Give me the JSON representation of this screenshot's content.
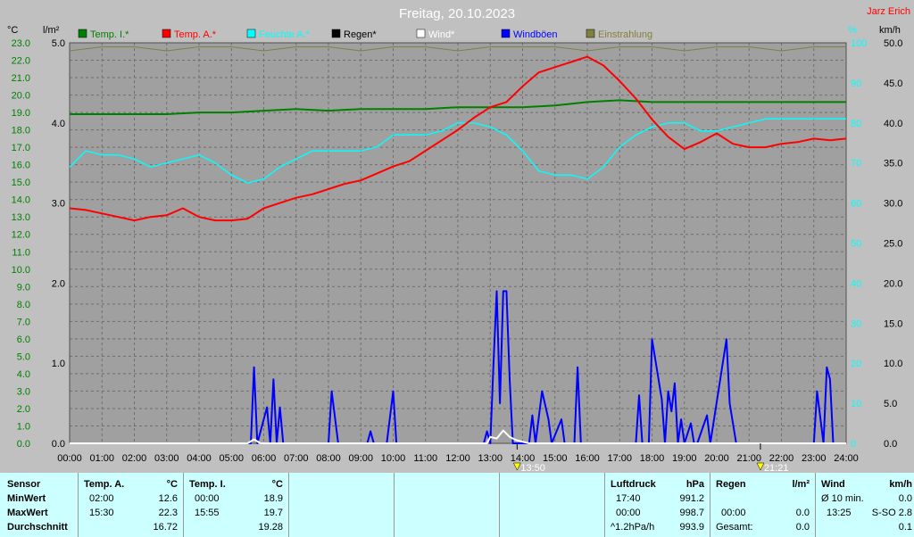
{
  "header": {
    "title": "Freitag, 20.10.2023",
    "station": "Jarz Erich",
    "unit_left1": "°C",
    "unit_left2": "l/m²",
    "unit_right1": "%",
    "unit_right2": "km/h"
  },
  "legend": [
    {
      "label": "Temp. I.*",
      "color": "#008000"
    },
    {
      "label": "Temp. A.*",
      "color": "#ff0000"
    },
    {
      "label": "Feuchte A.*",
      "color": "#00ffff"
    },
    {
      "label": "Regen*",
      "color": "#000000"
    },
    {
      "label": "Wind*",
      "color": "#ffffff"
    },
    {
      "label": "Windböen",
      "color": "#0000ff"
    },
    {
      "label": "Einstrahlung",
      "color": "#808040"
    }
  ],
  "colors": {
    "background": "#c0c0c0",
    "plot": "#a0a0a0",
    "temp_outdoor": "#ff0000",
    "temp_indoor": "#008000",
    "humidity": "#00ffff",
    "gusts": "#0000ff",
    "wind": "#ffffff",
    "solar": "#808040",
    "axis_temp": "#008000",
    "axis_rain": "#000000",
    "axis_pct": "#00ffff",
    "axis_kmh": "#000000",
    "stats_bg": "#ccffff",
    "station": "#ff0000"
  },
  "markers": [
    {
      "time": "13:50",
      "hour": 13.83
    },
    {
      "time": "21:21",
      "hour": 21.35
    }
  ],
  "chart_data": {
    "type": "line",
    "x_unit": "hour of day",
    "xlim": [
      0,
      24
    ],
    "x_ticks": [
      "00:00",
      "01:00",
      "02:00",
      "03:00",
      "04:00",
      "05:00",
      "06:00",
      "07:00",
      "08:00",
      "09:00",
      "10:00",
      "11:00",
      "12:00",
      "13:00",
      "14:00",
      "15:00",
      "16:00",
      "17:00",
      "18:00",
      "19:00",
      "20:00",
      "21:00",
      "22:00",
      "23:00",
      "24:00"
    ],
    "axes": {
      "temp_c": {
        "range": [
          0,
          23
        ],
        "ticks": [
          "0.0",
          "1.0",
          "2.0",
          "3.0",
          "4.0",
          "5.0",
          "6.0",
          "7.0",
          "8.0",
          "9.0",
          "10.0",
          "11.0",
          "12.0",
          "13.0",
          "14.0",
          "15.0",
          "16.0",
          "17.0",
          "18.0",
          "19.0",
          "20.0",
          "21.0",
          "22.0",
          "23.0"
        ]
      },
      "rain_lm2": {
        "range": [
          0,
          5
        ],
        "ticks": [
          "0.0",
          "1.0",
          "2.0",
          "3.0",
          "4.0",
          "5.0"
        ]
      },
      "humidity_pct": {
        "range": [
          0,
          100
        ],
        "ticks": [
          "0",
          "10",
          "20",
          "30",
          "40",
          "50",
          "60",
          "70",
          "80",
          "90",
          "100"
        ]
      },
      "wind_kmh": {
        "range": [
          0,
          50
        ],
        "ticks": [
          "0.0",
          "5.0",
          "10.0",
          "15.0",
          "20.0",
          "25.0",
          "30.0",
          "35.0",
          "40.0",
          "45.0",
          "50.0"
        ]
      }
    },
    "series": [
      {
        "name": "Temp. A.*",
        "axis": "temp_c",
        "x": [
          0,
          0.5,
          1,
          1.5,
          2,
          2.5,
          3,
          3.5,
          4,
          4.5,
          5,
          5.5,
          6,
          6.5,
          7,
          7.5,
          8,
          8.5,
          9,
          9.5,
          10,
          10.5,
          11,
          11.5,
          12,
          12.5,
          13,
          13.5,
          14,
          14.5,
          15,
          15.5,
          16,
          16.5,
          17,
          17.5,
          18,
          18.5,
          19,
          19.5,
          20,
          20.5,
          21,
          21.5,
          22,
          22.5,
          23,
          23.5,
          24
        ],
        "values": [
          13.5,
          13.4,
          13.2,
          13.0,
          12.8,
          13.0,
          13.1,
          13.5,
          13.0,
          12.8,
          12.8,
          12.9,
          13.5,
          13.8,
          14.1,
          14.3,
          14.6,
          14.9,
          15.1,
          15.5,
          15.9,
          16.2,
          16.8,
          17.4,
          18.0,
          18.7,
          19.3,
          19.6,
          20.5,
          21.3,
          21.6,
          21.9,
          22.2,
          21.7,
          20.8,
          19.8,
          18.6,
          17.6,
          16.9,
          17.3,
          17.8,
          17.2,
          17.0,
          17.0,
          17.2,
          17.3,
          17.5,
          17.4,
          17.5
        ]
      },
      {
        "name": "Temp. I.*",
        "axis": "temp_c",
        "x": [
          0,
          1,
          2,
          3,
          4,
          5,
          6,
          7,
          8,
          9,
          10,
          11,
          12,
          13,
          14,
          15,
          16,
          17,
          18,
          19,
          20,
          21,
          22,
          23,
          24
        ],
        "values": [
          18.9,
          18.9,
          18.9,
          18.9,
          19.0,
          19.0,
          19.1,
          19.2,
          19.1,
          19.2,
          19.2,
          19.2,
          19.3,
          19.3,
          19.3,
          19.4,
          19.6,
          19.7,
          19.6,
          19.6,
          19.6,
          19.6,
          19.6,
          19.6,
          19.6
        ]
      },
      {
        "name": "Feuchte A.*",
        "axis": "humidity_pct",
        "x": [
          0,
          0.5,
          1,
          1.5,
          2,
          2.5,
          3,
          3.5,
          4,
          4.5,
          5,
          5.5,
          6,
          6.5,
          7,
          7.5,
          8,
          8.5,
          9,
          9.5,
          10,
          10.5,
          11,
          11.5,
          12,
          12.5,
          13,
          13.5,
          14,
          14.5,
          15,
          15.5,
          16,
          16.5,
          17,
          17.5,
          18,
          18.5,
          19,
          19.5,
          20,
          20.5,
          21,
          21.5,
          22,
          22.5,
          23,
          23.5,
          24
        ],
        "values": [
          69,
          73,
          72,
          72,
          71,
          69,
          70,
          71,
          72,
          70,
          67,
          65,
          66,
          69,
          71,
          73,
          73,
          73,
          73,
          74,
          77,
          77,
          77,
          78,
          80,
          80,
          79,
          77,
          73,
          68,
          67,
          67,
          66,
          69,
          74,
          77,
          79,
          80,
          80,
          78,
          78,
          79,
          80,
          81,
          81,
          81,
          81,
          81,
          81
        ]
      },
      {
        "name": "Einstrahlung",
        "axis": "humidity_pct",
        "x": [
          0,
          1,
          2,
          3,
          4,
          5,
          6,
          7,
          8,
          9,
          10,
          11,
          12,
          13,
          14,
          15,
          16,
          17,
          18,
          19,
          20,
          21,
          22,
          23,
          24
        ],
        "values": [
          98,
          99,
          99,
          98,
          99,
          99,
          98,
          99,
          99,
          98,
          99,
          99,
          98,
          99,
          99,
          99,
          98,
          99,
          99,
          98,
          99,
          99,
          98,
          99,
          99
        ]
      },
      {
        "name": "Windböen",
        "axis": "wind_kmh",
        "x": [
          0,
          5.6,
          5.7,
          5.8,
          6.1,
          6.2,
          6.3,
          6.4,
          6.5,
          6.6,
          6.7,
          8.0,
          8.1,
          8.3,
          9.2,
          9.3,
          9.4,
          9.8,
          10.0,
          10.1,
          12.8,
          12.9,
          13.0,
          13.1,
          13.2,
          13.3,
          13.4,
          13.5,
          13.6,
          13.7,
          14.2,
          14.3,
          14.4,
          14.6,
          14.8,
          14.9,
          15.2,
          15.3,
          15.4,
          15.6,
          15.7,
          15.8,
          16.0,
          16.1,
          17.5,
          17.6,
          17.7,
          17.9,
          18.0,
          18.3,
          18.4,
          18.5,
          18.6,
          18.7,
          18.8,
          18.9,
          19.0,
          19.2,
          19.3,
          19.4,
          19.7,
          19.8,
          20.3,
          20.4,
          20.6,
          23.0,
          23.1,
          23.3,
          23.4,
          23.5,
          23.6,
          24
        ],
        "values": [
          0,
          0,
          9.5,
          0,
          4.5,
          0,
          8,
          0,
          4.5,
          0,
          0,
          0,
          6.5,
          0,
          0,
          1.5,
          0,
          0,
          6.5,
          0,
          0,
          1.5,
          0,
          10,
          19,
          5,
          19,
          19,
          8,
          0,
          0,
          3.5,
          0,
          6.5,
          3,
          0,
          3,
          0,
          0,
          0,
          9.5,
          0,
          0,
          0,
          0,
          6,
          0,
          0,
          13,
          5.5,
          0,
          6.5,
          4,
          7.5,
          0,
          3,
          0,
          2.5,
          0,
          0,
          3.5,
          0,
          13,
          5,
          0,
          0,
          6.5,
          0,
          9.5,
          8,
          0,
          0
        ]
      },
      {
        "name": "Wind*",
        "axis": "wind_kmh",
        "x": [
          0,
          5.5,
          5.7,
          5.9,
          12.9,
          13.0,
          13.2,
          13.4,
          13.6,
          13.8,
          14.2,
          24
        ],
        "values": [
          0,
          0,
          0.5,
          0,
          0,
          0.8,
          0.6,
          1.6,
          0.8,
          0.4,
          0,
          0
        ]
      }
    ]
  },
  "stats": {
    "sensor": {
      "header": "Sensor",
      "rows": [
        "MinWert",
        "MaxWert",
        "Durchschnitt"
      ]
    },
    "temp_a": {
      "header": "Temp. A.",
      "unit": "°C",
      "min_time": "02:00",
      "min_val": "12.6",
      "max_time": "15:30",
      "max_val": "22.3",
      "avg": "16.72"
    },
    "temp_i": {
      "header": "Temp. I.",
      "unit": "°C",
      "min_time": "00:00",
      "min_val": "18.9",
      "max_time": "15:55",
      "max_val": "19.7",
      "avg": "19.28"
    },
    "pressure": {
      "header": "Luftdruck",
      "unit": "hPa",
      "min_time": "17:40",
      "min_val": "991.2",
      "max_time": "00:00",
      "max_val": "998.7",
      "trend": "^1.2hPa/h",
      "trend_val": "993.9"
    },
    "rain": {
      "header": "Regen",
      "unit": "l/m²",
      "max_time": "00:00",
      "max_val": "0.0",
      "min_val": "0.0",
      "total_label": "Gesamt:",
      "total_val": "0.0"
    },
    "wind": {
      "header": "Wind",
      "unit": "km/h",
      "avg_label": "Ø 10 min.",
      "avg_val": "0.0",
      "max_time": "13:25",
      "max_val": "S-SO 2.8",
      "last_val": "0.1"
    }
  }
}
